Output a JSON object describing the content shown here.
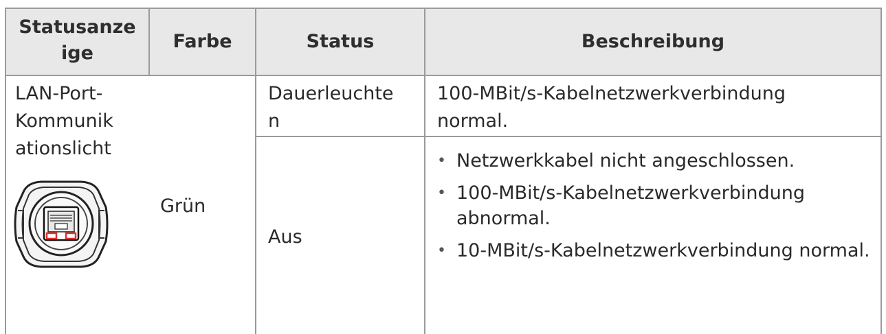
{
  "table": {
    "headers": [
      "Statusanze ige",
      "Farbe",
      "Status",
      "Beschreibung"
    ],
    "header_lines": {
      "col1_line1": "Statusanze",
      "col1_line2": "ige"
    },
    "row_indicator": {
      "line1": "LAN-Port-",
      "line2": "Kommunik",
      "line3": "ationslicht"
    },
    "color_value": "Grün",
    "status_on": {
      "line1": "Dauerleuchte",
      "line2": "n"
    },
    "status_on_description": {
      "line1": "100-MBit/s-Kabelnetzwerkverbindung",
      "line2": "normal."
    },
    "status_off": "Aus",
    "status_off_bullets": [
      "Netzwerkkabel nicht angeschlossen.",
      "100-MBit/s-Kabelnetzwerkverbindung abnormal.",
      "10-MBit/s-Kabelnetzwerkverbindung normal."
    ]
  },
  "colors": {
    "header_bg": "#e8e8e8",
    "grid": "#9a9a9a",
    "led_highlight": "#e03030"
  },
  "icons": {
    "port": "lan-port-icon"
  }
}
